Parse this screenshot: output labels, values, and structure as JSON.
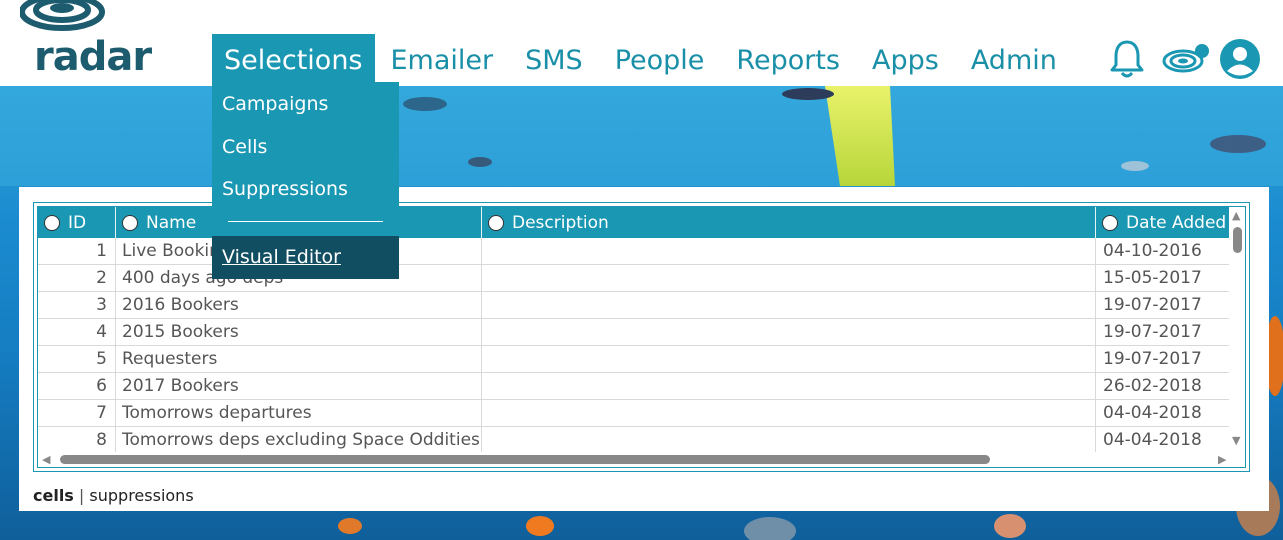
{
  "brand": {
    "logo_text": "radar",
    "color": "#1d5b6f"
  },
  "nav": {
    "items": [
      {
        "label": "Selections",
        "active": true
      },
      {
        "label": "Emailer"
      },
      {
        "label": "SMS"
      },
      {
        "label": "People"
      },
      {
        "label": "Reports"
      },
      {
        "label": "Apps"
      },
      {
        "label": "Admin"
      }
    ],
    "icons": [
      "bell-icon",
      "radar-notification-icon",
      "user-account-icon"
    ],
    "accent": "#1a97b2"
  },
  "dropdown": {
    "items": [
      "Campaigns",
      "Cells",
      "Suppressions",
      "Visual Editor"
    ]
  },
  "table": {
    "columns": [
      "ID",
      "Name",
      "Description",
      "Date Added"
    ],
    "rows": [
      {
        "id": "1",
        "name": "Live Bookin",
        "description": "",
        "date": "04-10-2016"
      },
      {
        "id": "2",
        "name": "400 days ago deps",
        "description": "",
        "date": "15-05-2017"
      },
      {
        "id": "3",
        "name": "2016 Bookers",
        "description": "",
        "date": "19-07-2017"
      },
      {
        "id": "4",
        "name": "2015 Bookers",
        "description": "",
        "date": "19-07-2017"
      },
      {
        "id": "5",
        "name": "Requesters",
        "description": "",
        "date": "19-07-2017"
      },
      {
        "id": "6",
        "name": "2017 Bookers",
        "description": "",
        "date": "26-02-2018"
      },
      {
        "id": "7",
        "name": "Tomorrows departures",
        "description": "",
        "date": "04-04-2018"
      },
      {
        "id": "8",
        "name": "Tomorrows deps excluding Space Oddities",
        "description": "",
        "date": "04-04-2018"
      }
    ]
  },
  "footer": {
    "cells": "cells",
    "separator": "|",
    "suppressions": "suppressions"
  }
}
